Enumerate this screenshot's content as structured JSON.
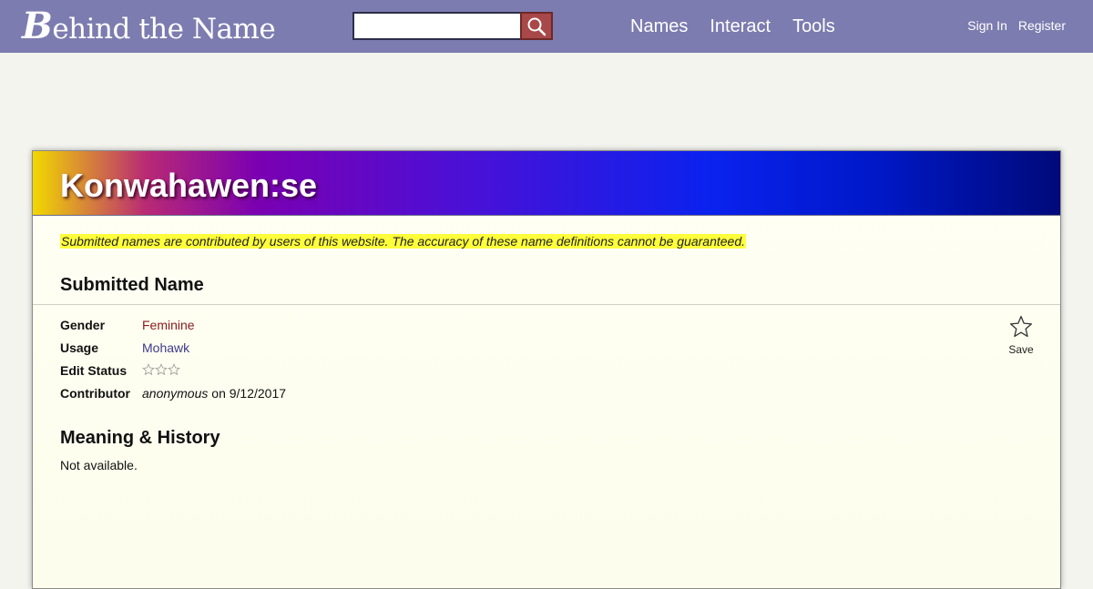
{
  "header": {
    "logo_initial": "B",
    "logo_rest": "ehind the Name",
    "search": {
      "value": "",
      "placeholder": ""
    },
    "search_icon": "magnifier-icon",
    "nav": [
      "Names",
      "Interact",
      "Tools"
    ],
    "account": {
      "sign_in": "Sign In",
      "register": "Register"
    },
    "colors": {
      "bar": "#7c7cb0",
      "search_button": "#a84848"
    }
  },
  "name_page": {
    "title": "Konwahawen:se",
    "disclaimer": "Submitted names are contributed by users of this website. The accuracy of these name definitions cannot be guaranteed.",
    "section_submitted": "Submitted Name",
    "info": {
      "gender": {
        "label": "Gender",
        "value": "Feminine"
      },
      "usage": {
        "label": "Usage",
        "value": "Mohawk"
      },
      "edit_status": {
        "label": "Edit Status",
        "stars_filled": 0,
        "stars_total": 3,
        "icon": "star-outline-icon"
      },
      "contributor": {
        "label": "Contributor",
        "name": "anonymous",
        "date_text": " on 9/12/2017"
      }
    },
    "save": {
      "label": "Save",
      "icon": "star-outline-icon"
    },
    "section_meaning": "Meaning & History",
    "meaning_text": "Not available."
  }
}
